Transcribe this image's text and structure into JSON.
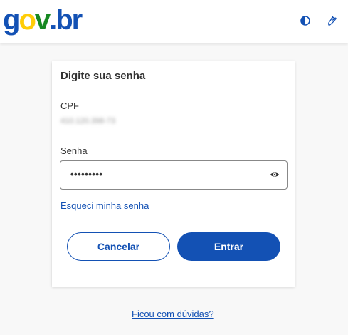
{
  "header": {
    "logo": {
      "g": "g",
      "o": "o",
      "v": "v",
      "dot": ".",
      "br": "br"
    },
    "icons": [
      "contrast-icon",
      "sign-language-icon"
    ]
  },
  "colors": {
    "primary": "#1351b4",
    "logo_blue": "#1351b4",
    "logo_yellow": "#ffcd07",
    "logo_green": "#168821",
    "text": "#333333"
  },
  "card": {
    "title": "Digite sua senha",
    "cpf_label": "CPF",
    "cpf_value": "410.120.398-73",
    "password_label": "Senha",
    "password_value": "•••••••••",
    "forgot_link": "Esqueci minha senha",
    "cancel_button": "Cancelar",
    "enter_button": "Entrar"
  },
  "footer": {
    "help_link": "Ficou com dúvidas?"
  }
}
